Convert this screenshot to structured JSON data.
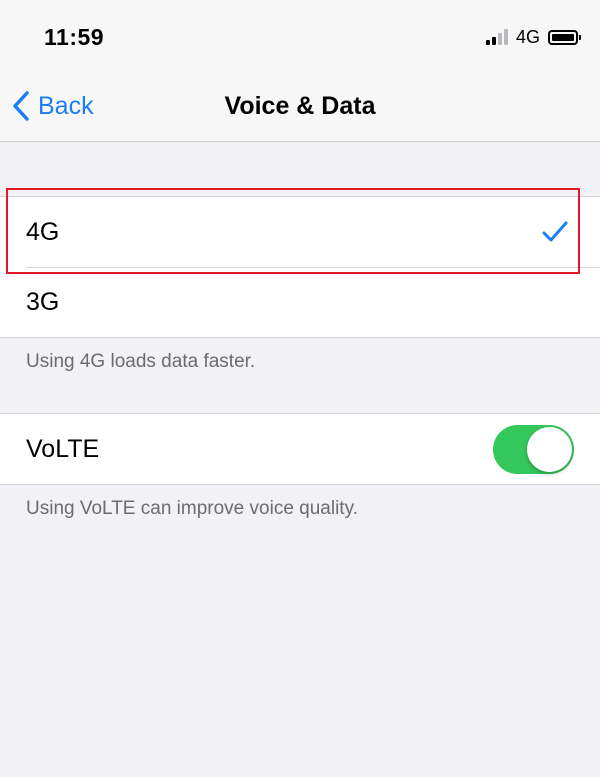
{
  "status_bar": {
    "time": "11:59",
    "network_label": "4G",
    "signal_icon": "cellular-signal-icon",
    "battery_icon": "battery-icon"
  },
  "nav": {
    "back_label": "Back",
    "title": "Voice & Data",
    "accent_color": "#1c7ef6"
  },
  "network_options": {
    "items": [
      {
        "label": "4G",
        "selected": true
      },
      {
        "label": "3G",
        "selected": false
      }
    ],
    "footnote": "Using 4G loads data faster."
  },
  "volte": {
    "label": "VoLTE",
    "enabled": true,
    "toggle_color": "#34c759",
    "footnote": "Using VoLTE can improve voice quality."
  },
  "highlight_color": "#e2172a"
}
